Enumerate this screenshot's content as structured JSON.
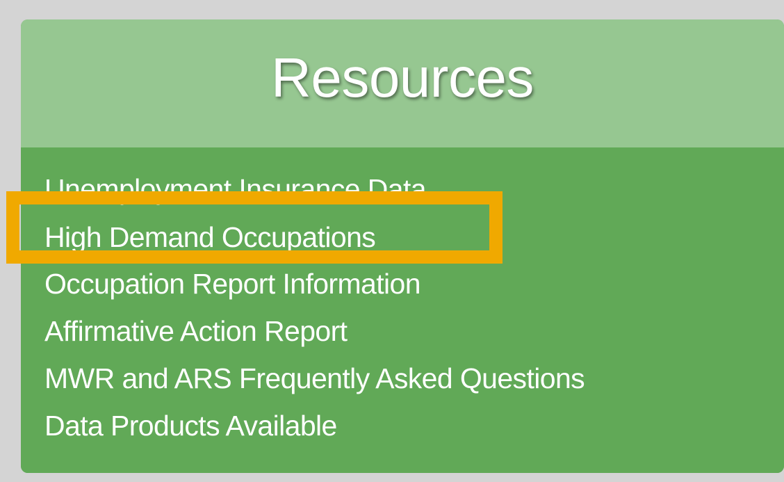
{
  "resources": {
    "title": "Resources",
    "links": [
      "Unemployment Insurance Data",
      "High Demand Occupations",
      "Occupation Report Information",
      "Affirmative Action Report",
      "MWR and ARS Frequently Asked Questions",
      "Data Products Available"
    ],
    "highlighted_link": "High Demand Occupations"
  },
  "colors": {
    "page_background": "#d4d4d4",
    "header_background": "#96c791",
    "body_background": "#61a957",
    "highlight_border": "#f0a900",
    "text": "#ffffff"
  }
}
